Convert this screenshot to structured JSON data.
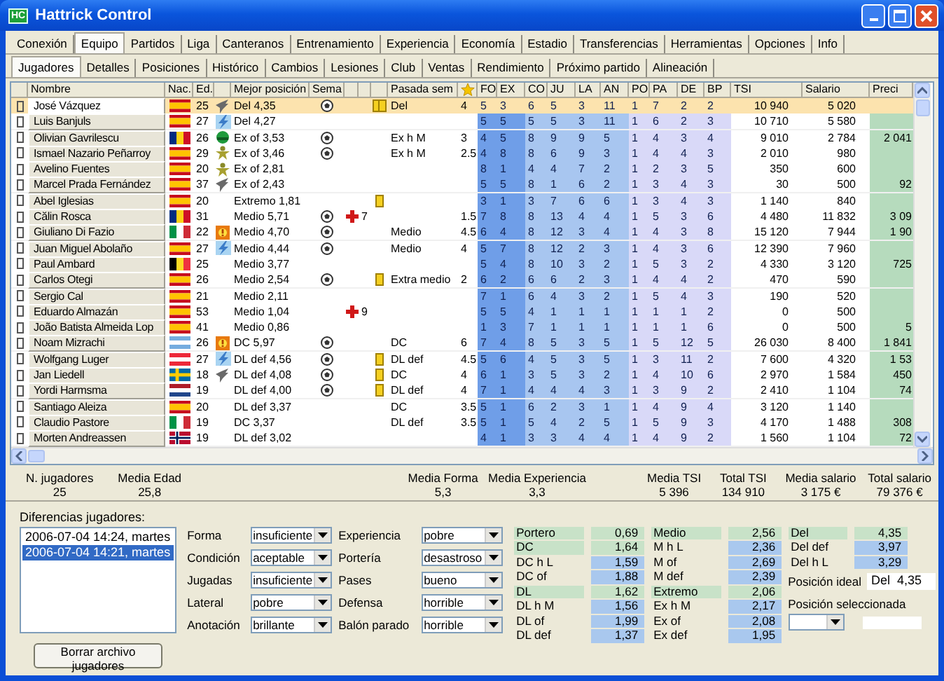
{
  "window": {
    "title": "Hattrick Control",
    "icon_text": "HC"
  },
  "menu_tabs": [
    {
      "label": "Conexión",
      "selected": false
    },
    {
      "label": "Equipo",
      "selected": true
    },
    {
      "label": "Partidos",
      "selected": false
    },
    {
      "label": "Liga",
      "selected": false
    },
    {
      "label": "Canteranos",
      "selected": false
    },
    {
      "label": "Entrenamiento",
      "selected": false
    },
    {
      "label": "Experiencia",
      "selected": false
    },
    {
      "label": "Economía",
      "selected": false
    },
    {
      "label": "Estadio",
      "selected": false
    },
    {
      "label": "Transferencias",
      "selected": false
    },
    {
      "label": "Herramientas",
      "selected": false
    },
    {
      "label": "Opciones",
      "selected": false
    },
    {
      "label": "Info",
      "selected": false
    }
  ],
  "sub_tabs": [
    {
      "label": "Jugadores",
      "selected": true
    },
    {
      "label": "Detalles",
      "selected": false
    },
    {
      "label": "Posiciones",
      "selected": false
    },
    {
      "label": "Histórico",
      "selected": false
    },
    {
      "label": "Cambios",
      "selected": false
    },
    {
      "label": "Lesiones",
      "selected": false
    },
    {
      "label": "Club",
      "selected": false
    },
    {
      "label": "Ventas",
      "selected": false
    },
    {
      "label": "Rendimiento",
      "selected": false
    },
    {
      "label": "Próximo partido",
      "selected": false
    },
    {
      "label": "Alineación",
      "selected": false
    }
  ],
  "columns": [
    {
      "kind": "blank"
    },
    {
      "kind": "text",
      "label": "Nombre"
    },
    {
      "kind": "text",
      "label": "Nac."
    },
    {
      "kind": "text",
      "label": "Ed."
    },
    {
      "kind": "blank"
    },
    {
      "kind": "text",
      "label": "Mejor posición"
    },
    {
      "kind": "text",
      "label": "Sema"
    },
    {
      "kind": "blank"
    },
    {
      "kind": "blank"
    },
    {
      "kind": "blank"
    },
    {
      "kind": "text",
      "label": "Pasada sem"
    },
    {
      "kind": "star"
    },
    {
      "kind": "text",
      "label": "FO"
    },
    {
      "kind": "text",
      "label": "EX"
    },
    {
      "kind": "text",
      "label": "CO"
    },
    {
      "kind": "text",
      "label": "JU"
    },
    {
      "kind": "text",
      "label": "LA"
    },
    {
      "kind": "text",
      "label": "AN"
    },
    {
      "kind": "text",
      "label": "PO"
    },
    {
      "kind": "text",
      "label": "PA"
    },
    {
      "kind": "text",
      "label": "DE"
    },
    {
      "kind": "text",
      "label": "BP"
    },
    {
      "kind": "text",
      "label": "TSI"
    },
    {
      "kind": "text",
      "label": "Salario"
    },
    {
      "kind": "text",
      "label": "Preci"
    }
  ],
  "players": [
    {
      "name": "José Vázquez",
      "flag": {
        "kind": "es"
      },
      "age": "25",
      "spec": {
        "kind": "wing"
      },
      "best": "Del  4,35",
      "played": true,
      "cards": {
        "kind": "two"
      },
      "last_pos": "Del",
      "rating": "4",
      "skills": [
        "5",
        "3",
        "6",
        "5",
        "3",
        "11",
        "1",
        "7",
        "2",
        "2"
      ],
      "tsi": "10 940",
      "salary": "5 020",
      "selected": true,
      "checked": false
    },
    {
      "name": "Luis Banjuls",
      "flag": {
        "kind": "es"
      },
      "age": "27",
      "spec": {
        "kind": "lightning"
      },
      "best": "Del  4,27",
      "played": false,
      "skills": [
        "5",
        "5",
        "5",
        "5",
        "3",
        "11",
        "1",
        "6",
        "2",
        "3"
      ],
      "tsi": "10 710",
      "salary": "5 580",
      "selected": false,
      "checked": false
    },
    {
      "name": "Olivian Gavrilescu",
      "flag": {
        "kind": "ro"
      },
      "age": "26",
      "spec": {
        "kind": "helmet"
      },
      "best": "Ex of  3,53",
      "played": true,
      "last_pos": "Ex h M",
      "rating": "3",
      "skills": [
        "4",
        "5",
        "8",
        "9",
        "9",
        "5",
        "1",
        "4",
        "3",
        "4"
      ],
      "tsi": "9 010",
      "salary": "2 784",
      "price": "2 041",
      "selected": false,
      "checked": false
    },
    {
      "name": "Ismael Nazario Peñarroy",
      "flag": {
        "kind": "es"
      },
      "age": "29",
      "spec": {
        "kind": "figure"
      },
      "best": "Ex of  3,46",
      "played": true,
      "last_pos": "Ex h M",
      "rating": "2.5",
      "skills": [
        "4",
        "8",
        "8",
        "6",
        "9",
        "3",
        "1",
        "4",
        "4",
        "3"
      ],
      "tsi": "2 010",
      "salary": "980",
      "selected": false,
      "checked": false
    },
    {
      "name": "Avelino Fuentes",
      "flag": {
        "kind": "es"
      },
      "age": "20",
      "spec": {
        "kind": "figure"
      },
      "best": "Ex of  2,81",
      "played": false,
      "skills": [
        "8",
        "1",
        "4",
        "4",
        "7",
        "2",
        "1",
        "2",
        "3",
        "5"
      ],
      "tsi": "350",
      "salary": "600",
      "selected": false,
      "checked": false
    },
    {
      "name": "Marcel Prada Fernández",
      "flag": {
        "kind": "es"
      },
      "age": "37",
      "spec": {
        "kind": "wing"
      },
      "best": "Ex of  2,43",
      "played": false,
      "skills": [
        "5",
        "5",
        "8",
        "1",
        "6",
        "2",
        "1",
        "3",
        "4",
        "3"
      ],
      "tsi": "30",
      "salary": "500",
      "price": "92",
      "selected": false,
      "checked": false
    },
    {
      "name": "Abel Iglesias",
      "flag": {
        "kind": "es"
      },
      "age": "20",
      "best": "Extremo  1,81",
      "played": false,
      "cards": {
        "kind": "one"
      },
      "skills": [
        "3",
        "1",
        "3",
        "7",
        "6",
        "6",
        "1",
        "3",
        "4",
        "3"
      ],
      "tsi": "1 140",
      "salary": "840",
      "selected": false,
      "checked": false
    },
    {
      "name": "Călin Rosca",
      "flag": {
        "kind": "ro"
      },
      "age": "31",
      "best": "Medio  5,71",
      "played": true,
      "injury": "7",
      "rating": "1.5",
      "skills": [
        "7",
        "8",
        "8",
        "13",
        "4",
        "4",
        "1",
        "5",
        "3",
        "6"
      ],
      "tsi": "4 480",
      "salary": "11 832",
      "price": "3 09",
      "selected": false,
      "checked": false
    },
    {
      "name": "Giuliano Di Fazio",
      "flag": {
        "kind": "it"
      },
      "age": "22",
      "spec": {
        "kind": "burst"
      },
      "best": "Medio  4,70",
      "played": true,
      "last_pos": "Medio",
      "rating": "4.5",
      "skills": [
        "6",
        "4",
        "8",
        "12",
        "3",
        "4",
        "1",
        "4",
        "3",
        "8"
      ],
      "tsi": "15 120",
      "salary": "7 944",
      "price": "1 90",
      "selected": false,
      "checked": false
    },
    {
      "name": "Juan Miguel Abolaño",
      "flag": {
        "kind": "es"
      },
      "age": "27",
      "spec": {
        "kind": "lightning"
      },
      "best": "Medio  4,44",
      "played": true,
      "last_pos": "Medio",
      "rating": "4",
      "skills": [
        "5",
        "7",
        "8",
        "12",
        "2",
        "3",
        "1",
        "4",
        "3",
        "6"
      ],
      "tsi": "12 390",
      "salary": "7 960",
      "selected": false,
      "checked": false
    },
    {
      "name": "Paul Ambard",
      "flag": {
        "kind": "be"
      },
      "age": "25",
      "best": "Medio  3,77",
      "played": false,
      "skills": [
        "5",
        "4",
        "8",
        "10",
        "3",
        "2",
        "1",
        "5",
        "3",
        "2"
      ],
      "tsi": "4 330",
      "salary": "3 120",
      "price": "725",
      "selected": false,
      "checked": false
    },
    {
      "name": "Carlos Otegi",
      "flag": {
        "kind": "es"
      },
      "age": "26",
      "best": "Medio  2,54",
      "played": true,
      "cards": {
        "kind": "one"
      },
      "last_pos": "Extra medio",
      "rating": "2",
      "skills": [
        "6",
        "2",
        "6",
        "6",
        "2",
        "3",
        "1",
        "4",
        "4",
        "2"
      ],
      "tsi": "470",
      "salary": "590",
      "selected": false,
      "checked": false
    },
    {
      "name": "Sergio Cal",
      "flag": {
        "kind": "es"
      },
      "age": "21",
      "best": "Medio  2,11",
      "played": false,
      "skills": [
        "7",
        "1",
        "6",
        "4",
        "3",
        "2",
        "1",
        "5",
        "4",
        "3"
      ],
      "tsi": "190",
      "salary": "520",
      "selected": false,
      "checked": false
    },
    {
      "name": "Eduardo Almazán",
      "flag": {
        "kind": "es"
      },
      "age": "53",
      "best": "Medio  1,04",
      "played": false,
      "injury": "9",
      "skills": [
        "5",
        "5",
        "4",
        "1",
        "1",
        "1",
        "1",
        "1",
        "1",
        "2"
      ],
      "tsi": "0",
      "salary": "500",
      "selected": false,
      "checked": false
    },
    {
      "name": "João Batista Almeida Lop",
      "flag": {
        "kind": "es"
      },
      "age": "41",
      "best": "Medio  0,86",
      "played": false,
      "skills": [
        "1",
        "3",
        "7",
        "1",
        "1",
        "1",
        "1",
        "1",
        "1",
        "6"
      ],
      "tsi": "0",
      "salary": "500",
      "price": "5",
      "selected": false,
      "checked": false
    },
    {
      "name": "Noam Mizrachi",
      "flag": {
        "kind": "ar"
      },
      "age": "26",
      "spec": {
        "kind": "burst"
      },
      "best": "DC  5,97",
      "played": true,
      "last_pos": "DC",
      "rating": "6",
      "skills": [
        "7",
        "4",
        "8",
        "5",
        "3",
        "5",
        "1",
        "5",
        "12",
        "5"
      ],
      "tsi": "26 030",
      "salary": "8 400",
      "price": "1 841",
      "selected": false,
      "checked": false
    },
    {
      "name": "Wolfgang Luger",
      "flag": {
        "kind": "at"
      },
      "age": "27",
      "spec": {
        "kind": "lightning"
      },
      "best": "DL def  4,56",
      "played": true,
      "cards": {
        "kind": "one"
      },
      "last_pos": "DL def",
      "rating": "4.5",
      "skills": [
        "5",
        "6",
        "4",
        "5",
        "3",
        "5",
        "1",
        "3",
        "11",
        "2"
      ],
      "tsi": "7 600",
      "salary": "4 320",
      "price": "1 53",
      "selected": false,
      "checked": false
    },
    {
      "name": "Jan Liedell",
      "flag": {
        "kind": "se"
      },
      "age": "18",
      "spec": {
        "kind": "wing"
      },
      "best": "DL def  4,08",
      "played": true,
      "cards": {
        "kind": "one"
      },
      "last_pos": "DC",
      "rating": "4",
      "skills": [
        "6",
        "1",
        "3",
        "5",
        "3",
        "2",
        "1",
        "4",
        "10",
        "6"
      ],
      "tsi": "2 970",
      "salary": "1 584",
      "price": "450",
      "selected": false,
      "checked": false
    },
    {
      "name": "Yordi Harmsma",
      "flag": {
        "kind": "nl"
      },
      "age": "19",
      "best": "DL def  4,00",
      "played": true,
      "cards": {
        "kind": "one"
      },
      "last_pos": "DL def",
      "rating": "4",
      "skills": [
        "7",
        "1",
        "4",
        "4",
        "4",
        "3",
        "1",
        "3",
        "9",
        "2"
      ],
      "tsi": "2 410",
      "salary": "1 104",
      "price": "74",
      "selected": false,
      "checked": false
    },
    {
      "name": "Santiago Aleiza",
      "flag": {
        "kind": "es"
      },
      "age": "20",
      "best": "DL def  3,37",
      "played": false,
      "last_pos": "DC",
      "rating": "3.5",
      "skills": [
        "5",
        "1",
        "6",
        "2",
        "3",
        "1",
        "1",
        "4",
        "9",
        "4"
      ],
      "tsi": "3 120",
      "salary": "1 140",
      "selected": false,
      "checked": false
    },
    {
      "name": "Claudio Pastore",
      "flag": {
        "kind": "it"
      },
      "age": "19",
      "best": "DC  3,37",
      "played": false,
      "last_pos": "DL def",
      "rating": "3.5",
      "skills": [
        "5",
        "1",
        "5",
        "4",
        "2",
        "5",
        "1",
        "5",
        "9",
        "3"
      ],
      "tsi": "4 170",
      "salary": "1 488",
      "price": "308",
      "selected": false,
      "checked": false
    },
    {
      "name": "Morten Andreassen",
      "flag": {
        "kind": "no"
      },
      "age": "19",
      "best": "DL def  3,02",
      "played": false,
      "skills": [
        "4",
        "1",
        "3",
        "3",
        "4",
        "4",
        "1",
        "4",
        "9",
        "2"
      ],
      "tsi": "1 560",
      "salary": "1 104",
      "price": "72",
      "selected": false,
      "checked": false
    }
  ],
  "stats": [
    {
      "label": "N. jugadores",
      "value": "25"
    },
    {
      "label": "Media Edad",
      "value": "25,8"
    },
    {
      "label": "Media Forma",
      "value": "5,3"
    },
    {
      "label": "Media Experiencia",
      "value": "3,3"
    },
    {
      "label": "Media TSI",
      "value": "5 396"
    },
    {
      "label": "Total TSI",
      "value": "134 910"
    },
    {
      "label": "Media salario",
      "value": "3 175 €"
    },
    {
      "label": "Total salario",
      "value": "79 376 €"
    }
  ],
  "differences": {
    "label": "Diferencias jugadores:",
    "items": [
      {
        "label": "2006-07-04 14:24, martes",
        "selected": false
      },
      {
        "label": "2006-07-04 14:21, martes",
        "selected": true
      }
    ],
    "button": "Borrar archivo jugadores"
  },
  "filters": [
    {
      "label": "Forma",
      "value": "insuficiente"
    },
    {
      "label": "Experiencia",
      "value": "pobre"
    },
    {
      "label": "Condición",
      "value": "aceptable"
    },
    {
      "label": "Portería",
      "value": "desastroso"
    },
    {
      "label": "Jugadas",
      "value": "insuficiente"
    },
    {
      "label": "Pases",
      "value": "bueno"
    },
    {
      "label": "Lateral",
      "value": "pobre"
    },
    {
      "label": "Defensa",
      "value": "horrible"
    },
    {
      "label": "Anotación",
      "value": "brillante"
    },
    {
      "label": "Balón parado",
      "value": "horrible"
    }
  ],
  "rating_columns": [
    [
      {
        "label": "Portero",
        "value": "0,69",
        "kind": "main"
      },
      {
        "label": "DC",
        "value": "1,64",
        "kind": "main"
      },
      {
        "label": "DC h L",
        "value": "1,59",
        "kind": "sub"
      },
      {
        "label": "DC of",
        "value": "1,88",
        "kind": "sub"
      },
      {
        "label": "DL",
        "value": "1,62",
        "kind": "main"
      },
      {
        "label": "DL h M",
        "value": "1,56",
        "kind": "sub"
      },
      {
        "label": "DL of",
        "value": "1,99",
        "kind": "sub"
      },
      {
        "label": "DL def",
        "value": "1,37",
        "kind": "sub"
      }
    ],
    [
      {
        "label": "Medio",
        "value": "2,56",
        "kind": "main"
      },
      {
        "label": "M h L",
        "value": "2,36",
        "kind": "sub"
      },
      {
        "label": "M of",
        "value": "2,69",
        "kind": "sub"
      },
      {
        "label": "M def",
        "value": "2,39",
        "kind": "sub"
      },
      {
        "label": "Extremo",
        "value": "2,06",
        "kind": "main"
      },
      {
        "label": "Ex h M",
        "value": "2,17",
        "kind": "sub"
      },
      {
        "label": "Ex of",
        "value": "2,08",
        "kind": "sub"
      },
      {
        "label": "Ex def",
        "value": "1,95",
        "kind": "sub"
      }
    ],
    [
      {
        "label": "Del",
        "value": "4,35",
        "kind": "main"
      },
      {
        "label": "Del def",
        "value": "3,97",
        "kind": "sub"
      },
      {
        "label": "Del h L",
        "value": "3,29",
        "kind": "sub"
      }
    ]
  ],
  "ideal": {
    "label": "Posición ideal",
    "value": "Del  4,35"
  },
  "selected_position": {
    "label": "Posición seleccionada"
  }
}
